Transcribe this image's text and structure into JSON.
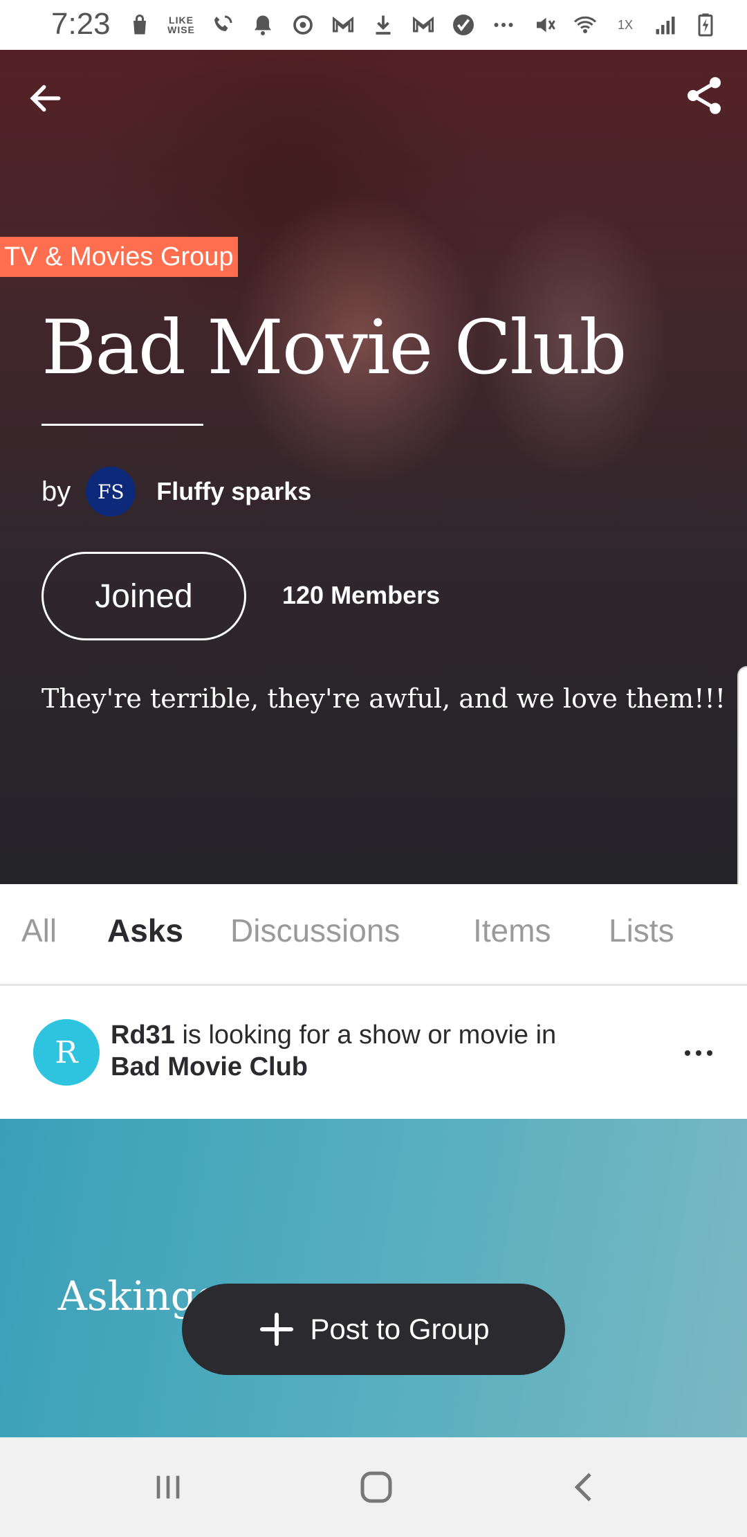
{
  "status_bar": {
    "time": "7:23",
    "left_icons": [
      "shopping-bag-icon",
      "likewise-icon",
      "wifi-call-icon",
      "bell-icon",
      "sync-icon",
      "gmail-icon",
      "download-icon",
      "gmail-icon",
      "check-badge-icon",
      "more-dots-icon"
    ],
    "likewise_label": "LIKE WISE",
    "speed_label": "1X",
    "right_icons": [
      "mute-icon",
      "wifi-icon",
      "signal-icon",
      "battery-charging-icon"
    ]
  },
  "hero": {
    "category": "TV & Movies Group",
    "title": "Bad Movie Club",
    "by_label": "by",
    "owner_initials": "FS",
    "owner_name": "Fluffy sparks",
    "joined_label": "Joined",
    "members": "120 Members",
    "description": "They're terrible, they're awful, and we love them!!!"
  },
  "tabs": [
    {
      "label": "All",
      "active": false
    },
    {
      "label": "Asks",
      "active": true
    },
    {
      "label": "Discussions",
      "active": false
    },
    {
      "label": "Items",
      "active": false
    },
    {
      "label": "Lists",
      "active": false
    }
  ],
  "post": {
    "avatar_initial": "R",
    "username": "Rd31",
    "action_text": " is looking for a show or movie in",
    "group_name": "Bad Movie Club"
  },
  "ask_banner": {
    "text": "Askingg"
  },
  "fab": {
    "label": "Post to Group"
  },
  "colors": {
    "badge": "#ff6f4f",
    "owner_avatar": "#0d2a7a",
    "poster_avatar": "#2ec4e0",
    "fab": "#2b2b2f",
    "banner_start": "#3aa0b8",
    "banner_end": "#7ab8c3"
  }
}
